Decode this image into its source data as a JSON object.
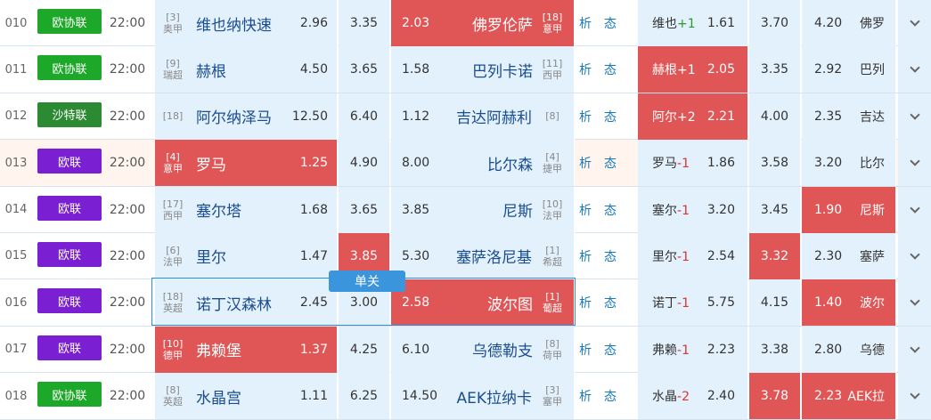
{
  "colors": {
    "green": "#1ea82a",
    "dark_green": "#2b8a32",
    "purple": "#7b1fd3",
    "highlight": "#e05555",
    "cell": "#e3f1fc"
  },
  "single_badge": "单关",
  "links": {
    "analysis": "析",
    "form": "态"
  },
  "rows": [
    {
      "num": "010",
      "league": "欧协联",
      "league_color": "#1ea82a",
      "time": "22:00",
      "home": {
        "rank": "[3]",
        "rank_sub": "奥甲",
        "name": "维也纳快速",
        "odds": "2.96",
        "hl": false
      },
      "draw": {
        "odds": "3.35",
        "hl": false
      },
      "away": {
        "rank": "[18]",
        "rank_sub": "意甲",
        "name": "佛罗伦萨",
        "odds": "2.03",
        "hl": true
      },
      "hcap": {
        "name": "维也",
        "sign": "+",
        "value": "1",
        "odds": "1.61",
        "hl": false
      },
      "hdraw": {
        "odds": "3.70",
        "hl": false
      },
      "haway": {
        "odds": "4.20",
        "name": "佛罗",
        "hl": false
      }
    },
    {
      "num": "011",
      "league": "欧协联",
      "league_color": "#1ea82a",
      "time": "22:00",
      "home": {
        "rank": "[9]",
        "rank_sub": "瑞超",
        "name": "赫根",
        "odds": "4.50",
        "hl": false
      },
      "draw": {
        "odds": "3.65",
        "hl": false
      },
      "away": {
        "rank": "[11]",
        "rank_sub": "西甲",
        "name": "巴列卡诺",
        "odds": "1.58",
        "hl": false
      },
      "hcap": {
        "name": "赫根",
        "sign": "+",
        "value": "1",
        "odds": "2.05",
        "hl": true
      },
      "hdraw": {
        "odds": "3.35",
        "hl": false
      },
      "haway": {
        "odds": "2.92",
        "name": "巴列",
        "hl": false
      }
    },
    {
      "num": "012",
      "league": "沙特联",
      "league_color": "#2b8a32",
      "time": "22:00",
      "home": {
        "rank": "[18]",
        "rank_sub": "",
        "name": "阿尔纳泽马",
        "odds": "12.50",
        "hl": false
      },
      "draw": {
        "odds": "6.40",
        "hl": false
      },
      "away": {
        "rank": "[8]",
        "rank_sub": "",
        "name": "吉达阿赫利",
        "odds": "1.12",
        "hl": false
      },
      "hcap": {
        "name": "阿尔",
        "sign": "+",
        "value": "2",
        "odds": "2.21",
        "hl": true
      },
      "hdraw": {
        "odds": "4.00",
        "hl": false
      },
      "haway": {
        "odds": "2.35",
        "name": "吉达",
        "hl": false
      }
    },
    {
      "num": "013",
      "league": "欧联",
      "league_color": "#7b1fd3",
      "time": "22:00",
      "alt": true,
      "home": {
        "rank": "[4]",
        "rank_sub": "意甲",
        "name": "罗马",
        "odds": "1.25",
        "hl": true
      },
      "draw": {
        "odds": "4.90",
        "hl": false
      },
      "away": {
        "rank": "[4]",
        "rank_sub": "捷甲",
        "name": "比尔森",
        "odds": "8.00",
        "hl": false
      },
      "hcap": {
        "name": "罗马",
        "sign": "-",
        "value": "1",
        "odds": "1.86",
        "hl": false
      },
      "hdraw": {
        "odds": "3.58",
        "hl": false
      },
      "haway": {
        "odds": "3.20",
        "name": "比尔",
        "hl": false
      }
    },
    {
      "num": "014",
      "league": "欧联",
      "league_color": "#7b1fd3",
      "time": "22:00",
      "home": {
        "rank": "[17]",
        "rank_sub": "西甲",
        "name": "塞尔塔",
        "odds": "1.68",
        "hl": false
      },
      "draw": {
        "odds": "3.65",
        "hl": false
      },
      "away": {
        "rank": "[10]",
        "rank_sub": "法甲",
        "name": "尼斯",
        "odds": "3.85",
        "hl": false
      },
      "hcap": {
        "name": "塞尔",
        "sign": "-",
        "value": "1",
        "odds": "3.20",
        "hl": false
      },
      "hdraw": {
        "odds": "3.45",
        "hl": false
      },
      "haway": {
        "odds": "1.90",
        "name": "尼斯",
        "hl": true
      }
    },
    {
      "num": "015",
      "league": "欧联",
      "league_color": "#7b1fd3",
      "time": "22:00",
      "home": {
        "rank": "[6]",
        "rank_sub": "法甲",
        "name": "里尔",
        "odds": "1.47",
        "hl": false
      },
      "draw": {
        "odds": "3.85",
        "hl": true
      },
      "away": {
        "rank": "[1]",
        "rank_sub": "希超",
        "name": "塞萨洛尼基",
        "odds": "5.30",
        "hl": false
      },
      "hcap": {
        "name": "里尔",
        "sign": "-",
        "value": "1",
        "odds": "2.54",
        "hl": false
      },
      "hdraw": {
        "odds": "3.32",
        "hl": true
      },
      "haway": {
        "odds": "2.30",
        "name": "塞萨",
        "hl": false
      }
    },
    {
      "num": "016",
      "league": "欧联",
      "league_color": "#7b1fd3",
      "time": "22:00",
      "home": {
        "rank": "[18]",
        "rank_sub": "英超",
        "name": "诺丁汉森林",
        "odds": "2.45",
        "hl": false
      },
      "draw": {
        "odds": "3.00",
        "hl": false
      },
      "away": {
        "rank": "[1]",
        "rank_sub": "葡超",
        "name": "波尔图",
        "odds": "2.58",
        "hl": true
      },
      "hcap": {
        "name": "诺丁",
        "sign": "-",
        "value": "1",
        "odds": "5.75",
        "hl": false
      },
      "hdraw": {
        "odds": "4.15",
        "hl": false
      },
      "haway": {
        "odds": "1.40",
        "name": "波尔",
        "hl": true
      }
    },
    {
      "num": "017",
      "league": "欧联",
      "league_color": "#7b1fd3",
      "time": "22:00",
      "home": {
        "rank": "[10]",
        "rank_sub": "德甲",
        "name": "弗赖堡",
        "odds": "1.37",
        "hl": true
      },
      "draw": {
        "odds": "4.25",
        "hl": false
      },
      "away": {
        "rank": "[8]",
        "rank_sub": "荷甲",
        "name": "乌德勒支",
        "odds": "6.10",
        "hl": false
      },
      "hcap": {
        "name": "弗赖",
        "sign": "-",
        "value": "1",
        "odds": "2.23",
        "hl": false
      },
      "hdraw": {
        "odds": "3.38",
        "hl": false
      },
      "haway": {
        "odds": "2.80",
        "name": "乌德",
        "hl": false
      }
    },
    {
      "num": "018",
      "league": "欧协联",
      "league_color": "#1ea82a",
      "time": "22:00",
      "home": {
        "rank": "[8]",
        "rank_sub": "英超",
        "name": "水晶宫",
        "odds": "1.11",
        "hl": false
      },
      "draw": {
        "odds": "6.25",
        "hl": false
      },
      "away": {
        "rank": "[3]",
        "rank_sub": "塞甲",
        "name": "AEK拉纳卡",
        "odds": "14.50",
        "hl": false
      },
      "hcap": {
        "name": "水晶",
        "sign": "-",
        "value": "2",
        "odds": "2.40",
        "hl": false
      },
      "hdraw": {
        "odds": "3.78",
        "hl": true
      },
      "haway": {
        "odds": "2.23",
        "name": "AEK拉",
        "hl": true
      }
    }
  ]
}
